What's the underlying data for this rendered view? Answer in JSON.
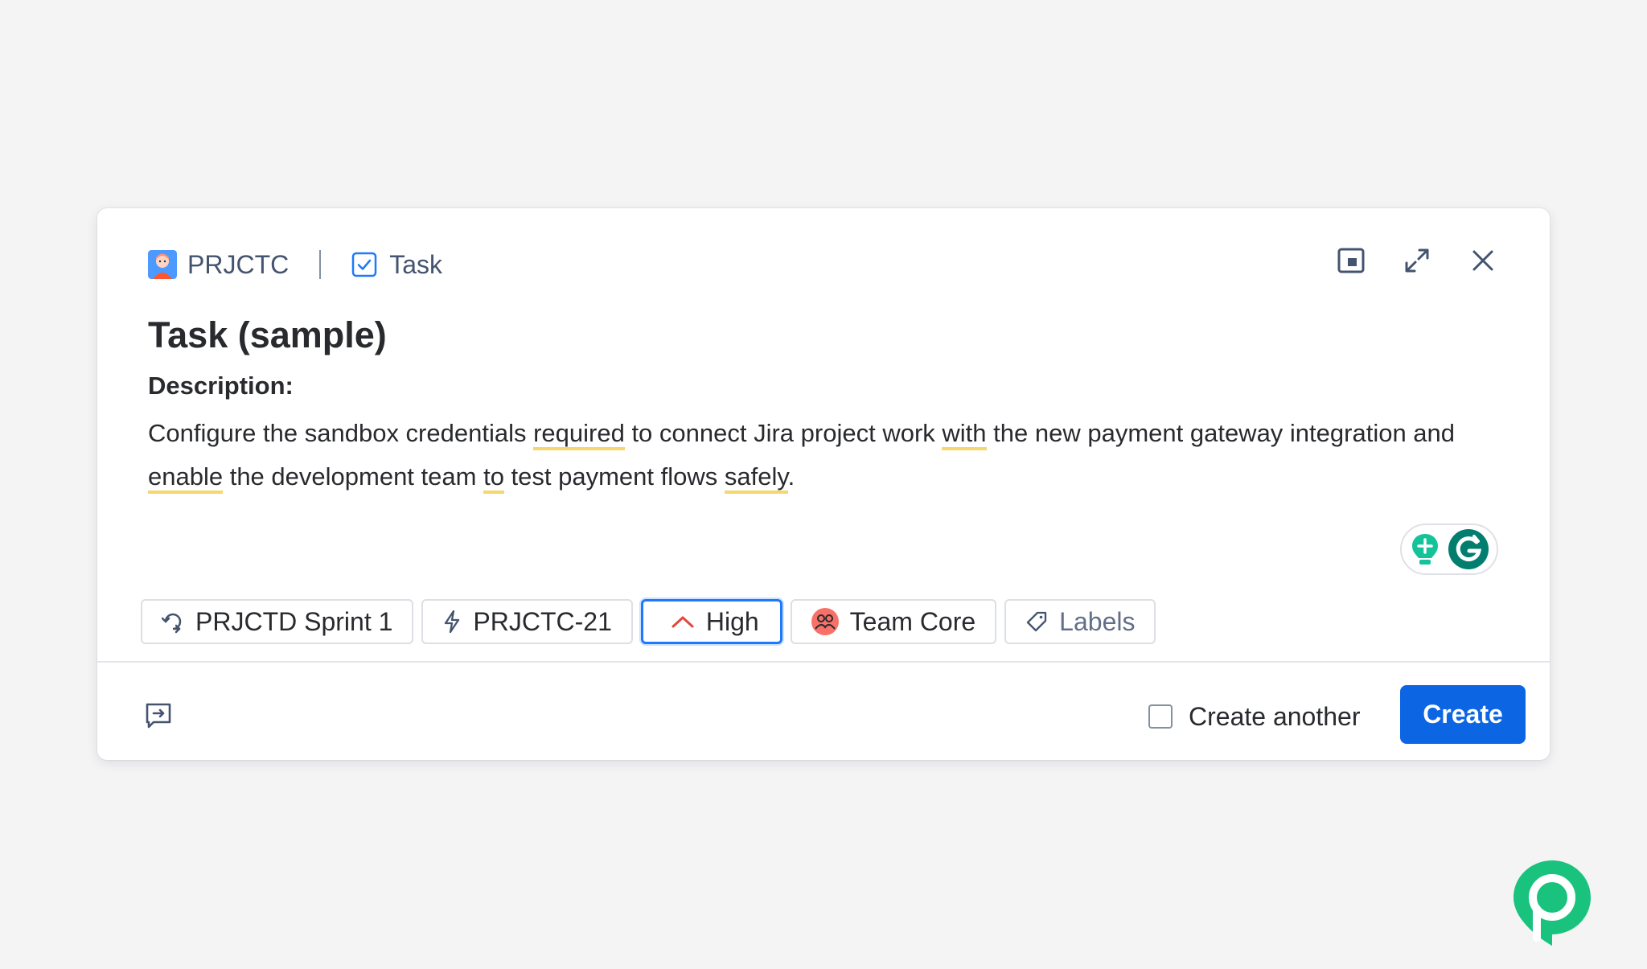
{
  "header": {
    "project": "PRJCTC",
    "issue_type": "Task"
  },
  "title": "Task (sample)",
  "description": {
    "label": "Description:",
    "segments": [
      {
        "text": "Configure the sandbox credentials ",
        "u": false
      },
      {
        "text": "required",
        "u": true
      },
      {
        "text": " to connect Jira project work ",
        "u": false
      },
      {
        "text": "with",
        "u": true
      },
      {
        "text": " the new payment gateway integration and ",
        "u": false
      },
      {
        "text": "enable",
        "u": true
      },
      {
        "text": " the development team ",
        "u": false
      },
      {
        "text": "to",
        "u": true
      },
      {
        "text": " test payment flows ",
        "u": false
      },
      {
        "text": "safely",
        "u": true
      },
      {
        "text": ".",
        "u": false
      }
    ]
  },
  "chips": {
    "sprint": "PRJCTD Sprint 1",
    "parent": "PRJCTC-21",
    "priority": "High",
    "team": "Team Core",
    "labels": "Labels"
  },
  "footer": {
    "create_another": "Create another",
    "create": "Create"
  },
  "colors": {
    "primary": "#0c66e4",
    "priority_high": "#e2483d",
    "grammar_underline": "#f5d76e",
    "grammarly": "#15c39a",
    "brand": "#19c37d"
  },
  "icons": {
    "project": "project-avatar-icon",
    "task": "task-checkbox-icon",
    "minimize": "minimize-window-icon",
    "expand": "expand-icon",
    "close": "close-icon",
    "sprint": "sprint-icon",
    "parent": "lightning-icon",
    "priority": "chevron-up-icon",
    "team": "team-avatar-icon",
    "labels": "tag-icon",
    "feedback": "feedback-icon"
  }
}
